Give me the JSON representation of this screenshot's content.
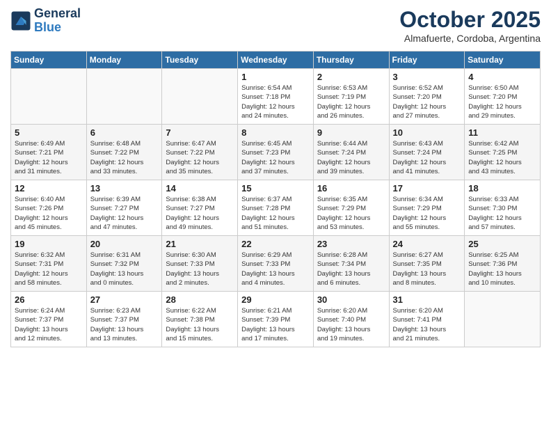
{
  "header": {
    "logo_line1": "General",
    "logo_line2": "Blue",
    "month": "October 2025",
    "location": "Almafuerte, Cordoba, Argentina"
  },
  "days_of_week": [
    "Sunday",
    "Monday",
    "Tuesday",
    "Wednesday",
    "Thursday",
    "Friday",
    "Saturday"
  ],
  "weeks": [
    [
      {
        "day": "",
        "info": ""
      },
      {
        "day": "",
        "info": ""
      },
      {
        "day": "",
        "info": ""
      },
      {
        "day": "1",
        "info": "Sunrise: 6:54 AM\nSunset: 7:18 PM\nDaylight: 12 hours\nand 24 minutes."
      },
      {
        "day": "2",
        "info": "Sunrise: 6:53 AM\nSunset: 7:19 PM\nDaylight: 12 hours\nand 26 minutes."
      },
      {
        "day": "3",
        "info": "Sunrise: 6:52 AM\nSunset: 7:20 PM\nDaylight: 12 hours\nand 27 minutes."
      },
      {
        "day": "4",
        "info": "Sunrise: 6:50 AM\nSunset: 7:20 PM\nDaylight: 12 hours\nand 29 minutes."
      }
    ],
    [
      {
        "day": "5",
        "info": "Sunrise: 6:49 AM\nSunset: 7:21 PM\nDaylight: 12 hours\nand 31 minutes."
      },
      {
        "day": "6",
        "info": "Sunrise: 6:48 AM\nSunset: 7:22 PM\nDaylight: 12 hours\nand 33 minutes."
      },
      {
        "day": "7",
        "info": "Sunrise: 6:47 AM\nSunset: 7:22 PM\nDaylight: 12 hours\nand 35 minutes."
      },
      {
        "day": "8",
        "info": "Sunrise: 6:45 AM\nSunset: 7:23 PM\nDaylight: 12 hours\nand 37 minutes."
      },
      {
        "day": "9",
        "info": "Sunrise: 6:44 AM\nSunset: 7:24 PM\nDaylight: 12 hours\nand 39 minutes."
      },
      {
        "day": "10",
        "info": "Sunrise: 6:43 AM\nSunset: 7:24 PM\nDaylight: 12 hours\nand 41 minutes."
      },
      {
        "day": "11",
        "info": "Sunrise: 6:42 AM\nSunset: 7:25 PM\nDaylight: 12 hours\nand 43 minutes."
      }
    ],
    [
      {
        "day": "12",
        "info": "Sunrise: 6:40 AM\nSunset: 7:26 PM\nDaylight: 12 hours\nand 45 minutes."
      },
      {
        "day": "13",
        "info": "Sunrise: 6:39 AM\nSunset: 7:27 PM\nDaylight: 12 hours\nand 47 minutes."
      },
      {
        "day": "14",
        "info": "Sunrise: 6:38 AM\nSunset: 7:27 PM\nDaylight: 12 hours\nand 49 minutes."
      },
      {
        "day": "15",
        "info": "Sunrise: 6:37 AM\nSunset: 7:28 PM\nDaylight: 12 hours\nand 51 minutes."
      },
      {
        "day": "16",
        "info": "Sunrise: 6:35 AM\nSunset: 7:29 PM\nDaylight: 12 hours\nand 53 minutes."
      },
      {
        "day": "17",
        "info": "Sunrise: 6:34 AM\nSunset: 7:29 PM\nDaylight: 12 hours\nand 55 minutes."
      },
      {
        "day": "18",
        "info": "Sunrise: 6:33 AM\nSunset: 7:30 PM\nDaylight: 12 hours\nand 57 minutes."
      }
    ],
    [
      {
        "day": "19",
        "info": "Sunrise: 6:32 AM\nSunset: 7:31 PM\nDaylight: 12 hours\nand 58 minutes."
      },
      {
        "day": "20",
        "info": "Sunrise: 6:31 AM\nSunset: 7:32 PM\nDaylight: 13 hours\nand 0 minutes."
      },
      {
        "day": "21",
        "info": "Sunrise: 6:30 AM\nSunset: 7:33 PM\nDaylight: 13 hours\nand 2 minutes."
      },
      {
        "day": "22",
        "info": "Sunrise: 6:29 AM\nSunset: 7:33 PM\nDaylight: 13 hours\nand 4 minutes."
      },
      {
        "day": "23",
        "info": "Sunrise: 6:28 AM\nSunset: 7:34 PM\nDaylight: 13 hours\nand 6 minutes."
      },
      {
        "day": "24",
        "info": "Sunrise: 6:27 AM\nSunset: 7:35 PM\nDaylight: 13 hours\nand 8 minutes."
      },
      {
        "day": "25",
        "info": "Sunrise: 6:25 AM\nSunset: 7:36 PM\nDaylight: 13 hours\nand 10 minutes."
      }
    ],
    [
      {
        "day": "26",
        "info": "Sunrise: 6:24 AM\nSunset: 7:37 PM\nDaylight: 13 hours\nand 12 minutes."
      },
      {
        "day": "27",
        "info": "Sunrise: 6:23 AM\nSunset: 7:37 PM\nDaylight: 13 hours\nand 13 minutes."
      },
      {
        "day": "28",
        "info": "Sunrise: 6:22 AM\nSunset: 7:38 PM\nDaylight: 13 hours\nand 15 minutes."
      },
      {
        "day": "29",
        "info": "Sunrise: 6:21 AM\nSunset: 7:39 PM\nDaylight: 13 hours\nand 17 minutes."
      },
      {
        "day": "30",
        "info": "Sunrise: 6:20 AM\nSunset: 7:40 PM\nDaylight: 13 hours\nand 19 minutes."
      },
      {
        "day": "31",
        "info": "Sunrise: 6:20 AM\nSunset: 7:41 PM\nDaylight: 13 hours\nand 21 minutes."
      },
      {
        "day": "",
        "info": ""
      }
    ]
  ]
}
